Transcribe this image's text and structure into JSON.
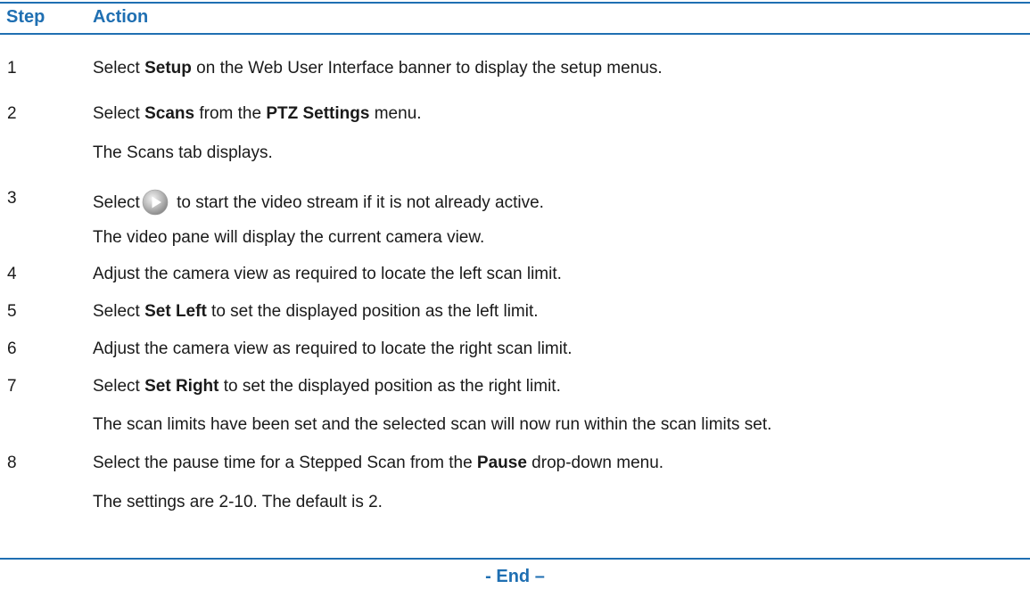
{
  "header": {
    "step": "Step",
    "action": "Action"
  },
  "steps": [
    {
      "num": "1",
      "pre": "Select ",
      "b1": "Setup",
      "post": " on the Web User Interface banner to display the setup menus."
    },
    {
      "num": "2",
      "pre": "Select ",
      "b1": "Scans",
      "mid": " from the ",
      "b2": "PTZ Settings",
      "post": " menu."
    },
    {
      "result": "The Scans tab displays."
    },
    {
      "num": "3",
      "pre": "Select",
      "icon": "play-button-icon",
      "post": " to start the video stream if it is not already active."
    },
    {
      "result": "The video pane will display the current camera view."
    },
    {
      "num": "4",
      "text": "Adjust the camera view as required to locate the left scan limit."
    },
    {
      "num": "5",
      "pre": "Select ",
      "b1": "Set Left",
      "post": " to set the displayed position as the left limit."
    },
    {
      "num": "6",
      "text": "Adjust the camera view as required to locate the right scan limit."
    },
    {
      "num": "7",
      "pre": "Select ",
      "b1": "Set Right",
      "post": " to set the displayed position as the right limit."
    },
    {
      "result": "The scan limits have been set and the selected scan will now run within the scan limits set."
    },
    {
      "num": "8",
      "pre": "Select the pause time for a Stepped Scan from the ",
      "b1": "Pause",
      "post": " drop-down menu."
    },
    {
      "result": "The settings are 2-10. The default is 2."
    }
  ],
  "footer": {
    "end": "- End –"
  },
  "colors": {
    "accent": "#1f6fb2"
  }
}
